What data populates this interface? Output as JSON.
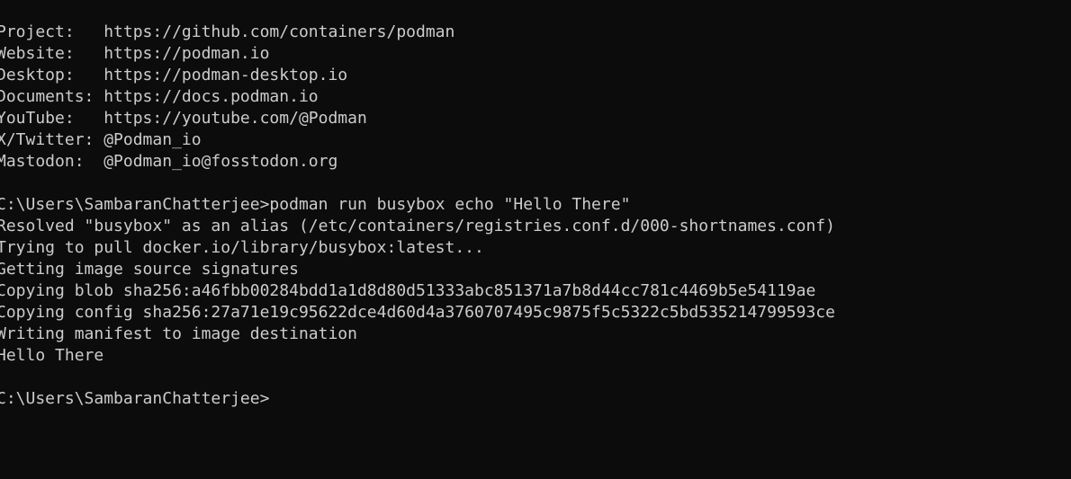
{
  "terminal": {
    "background": "#0c0c0c",
    "foreground": "#cccccc",
    "lines": [
      "Project:   https://github.com/containers/podman",
      "Website:   https://podman.io",
      "Desktop:   https://podman-desktop.io",
      "Documents: https://docs.podman.io",
      "YouTube:   https://youtube.com/@Podman",
      "X/Twitter: @Podman_io",
      "Mastodon:  @Podman_io@fosstodon.org",
      "",
      "C:\\Users\\SambaranChatterjee>podman run busybox echo \"Hello There\"",
      "Resolved \"busybox\" as an alias (/etc/containers/registries.conf.d/000-shortnames.conf)",
      "Trying to pull docker.io/library/busybox:latest...",
      "Getting image source signatures",
      "Copying blob sha256:a46fbb00284bdd1a1d8d80d51333abc851371a7b8d44cc781c4469b5e54119ae",
      "Copying config sha256:27a71e19c95622dce4d60d4a3760707495c9875f5c5322c5bd535214799593ce",
      "Writing manifest to image destination",
      "Hello There",
      ""
    ],
    "prompt": "C:\\Users\\SambaranChatterjee>",
    "input": ""
  }
}
